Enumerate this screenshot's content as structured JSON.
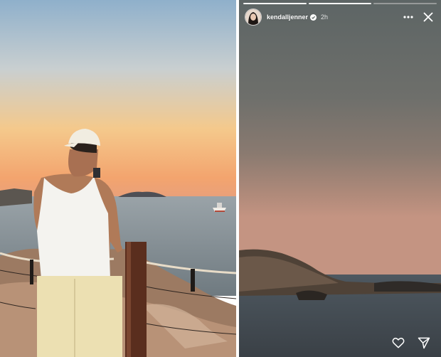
{
  "story": {
    "username": "kendalljenner",
    "time": "2h",
    "progress_done": 2,
    "progress_total": 3
  },
  "icons": {
    "verified": "verified-badge-icon",
    "more": "more-options-icon",
    "close": "close-icon",
    "like": "heart-icon",
    "send": "send-icon"
  },
  "colors": {
    "sky_top": "#93b4cd",
    "sunset": "#f3a870",
    "sea": "#75828a",
    "story_sky": "#616868",
    "story_dusk": "#b68a78"
  }
}
